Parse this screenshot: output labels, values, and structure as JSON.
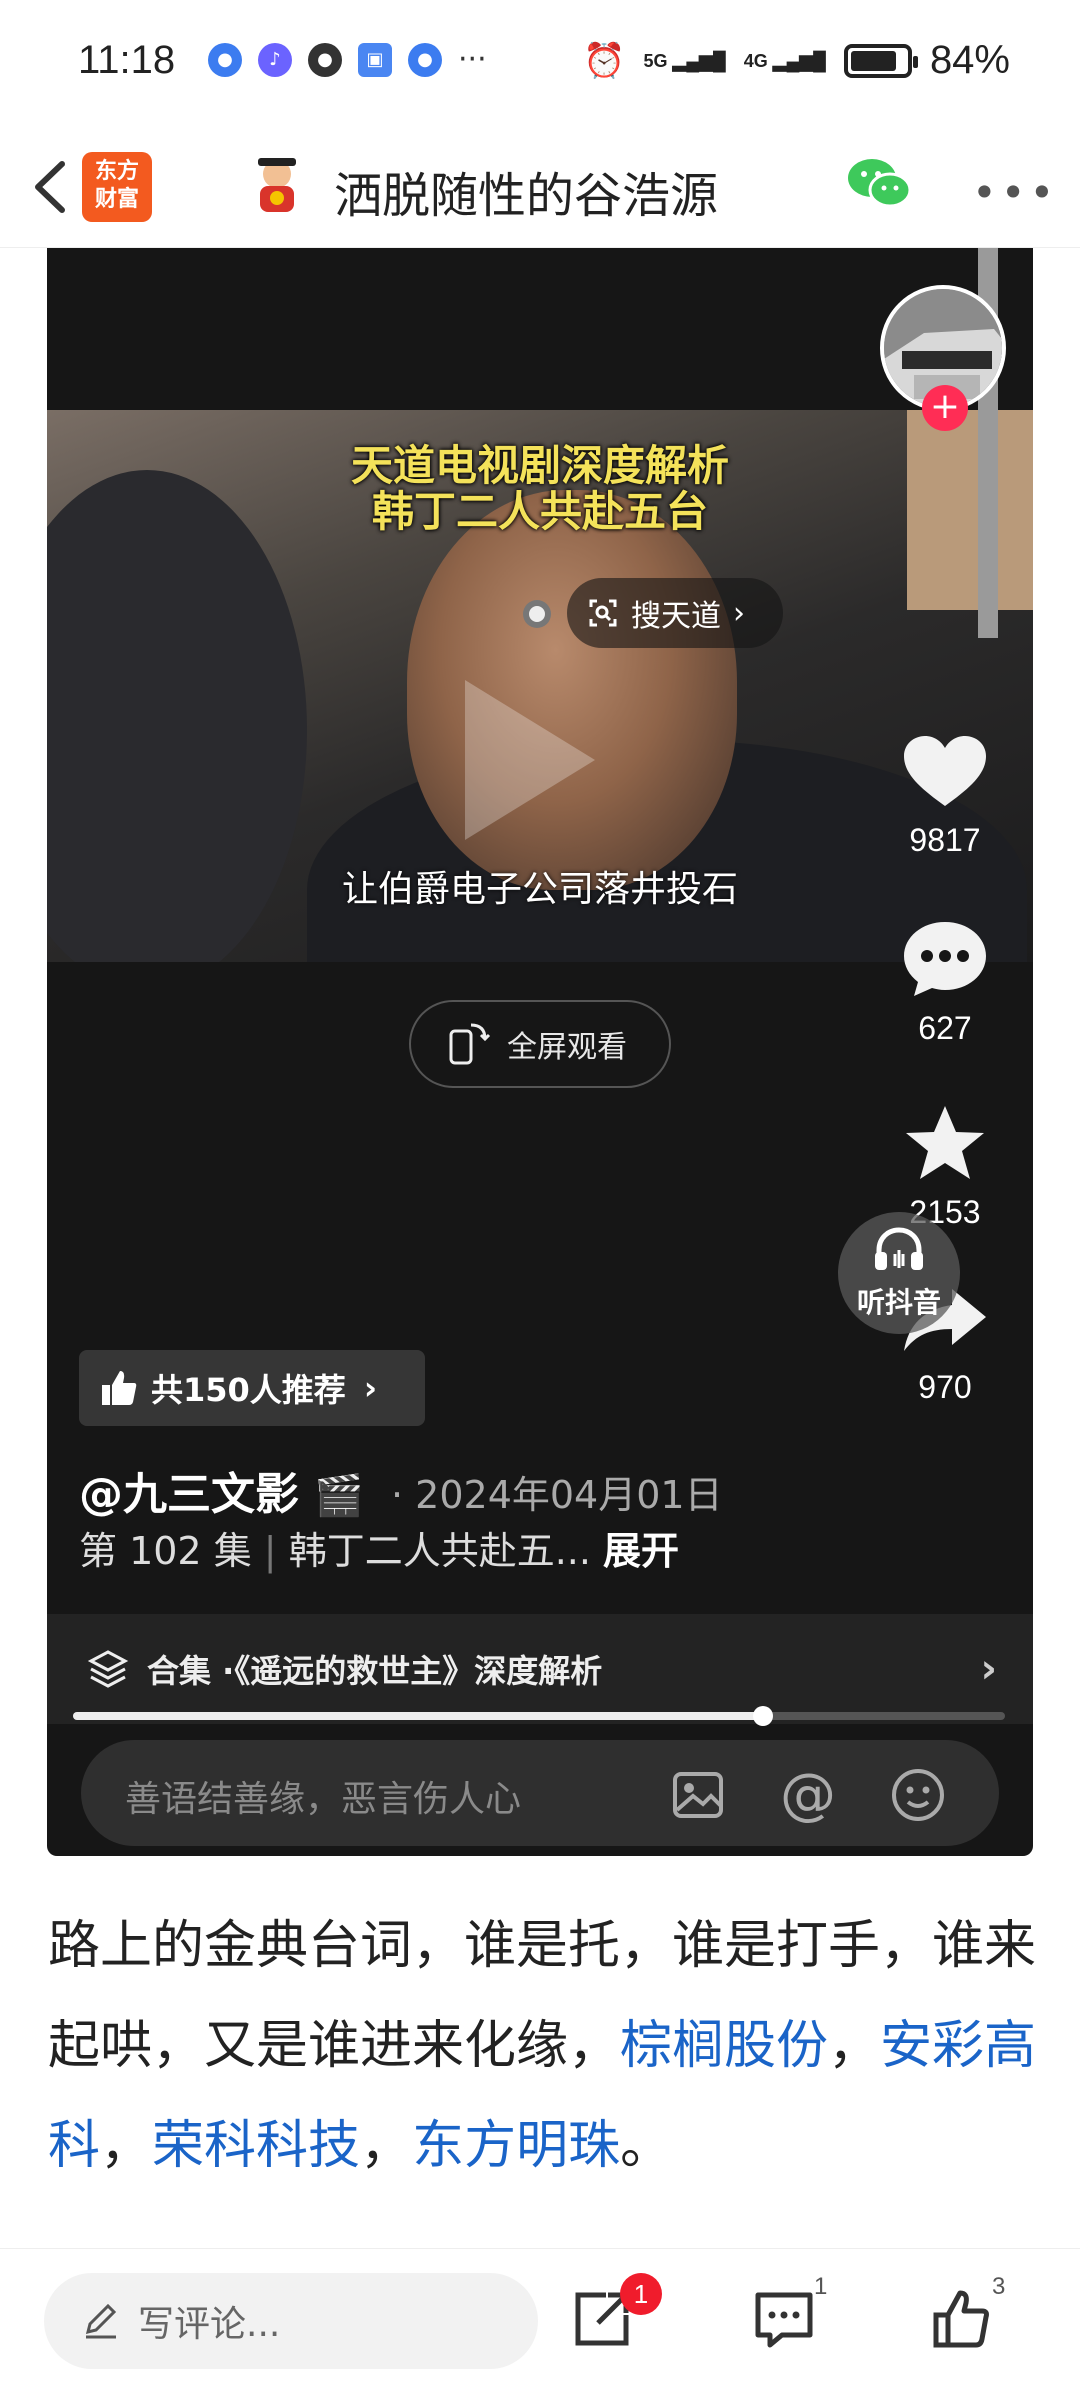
{
  "status_bar": {
    "time": "11:18",
    "signal1": "5G",
    "signal2": "4G",
    "battery": "84%",
    "battery_level": 0.84
  },
  "header": {
    "logo_line1": "东方",
    "logo_line2": "财富",
    "title": "洒脱随性的谷浩源"
  },
  "video": {
    "title_line1": "天道电视剧深度解析",
    "title_line2": "韩丁二人共赴五台",
    "search_label": "搜天道",
    "subtitle": "让伯爵电子公司落井投石",
    "fullscreen_label": "全屏观看",
    "likes": "9817",
    "comments": "627",
    "favorites": "2153",
    "shares": "970",
    "listen_label": "听抖音",
    "recommend_label": "共150人推荐",
    "author": "@九三文影",
    "date": "· 2024年04月01日",
    "episode": "第 102 集",
    "episode_title": "韩丁二人共赴五...",
    "expand_label": "展开",
    "collection_label": "合集 ·《遥远的救世主》深度解析",
    "progress": 0.74,
    "comment_placeholder": "善语结善缘，恶言伤人心"
  },
  "article": {
    "text_plain": "路上的金典台词，谁是托，谁是打手，谁来起哄，又是谁进来化缘，",
    "links": [
      "棕榈股份",
      "安彩高科",
      "荣科科技",
      "东方明珠"
    ],
    "sep": "，",
    "end": "。"
  },
  "bottom_bar": {
    "write_placeholder": "写评论...",
    "share_badge": "1",
    "comment_count": "1",
    "like_count": "3"
  },
  "colors": {
    "link": "#1a64c8",
    "brand_orange": "#f35a1f",
    "badge_red": "#f01c2c",
    "follow_pink": "#ff2d55"
  }
}
